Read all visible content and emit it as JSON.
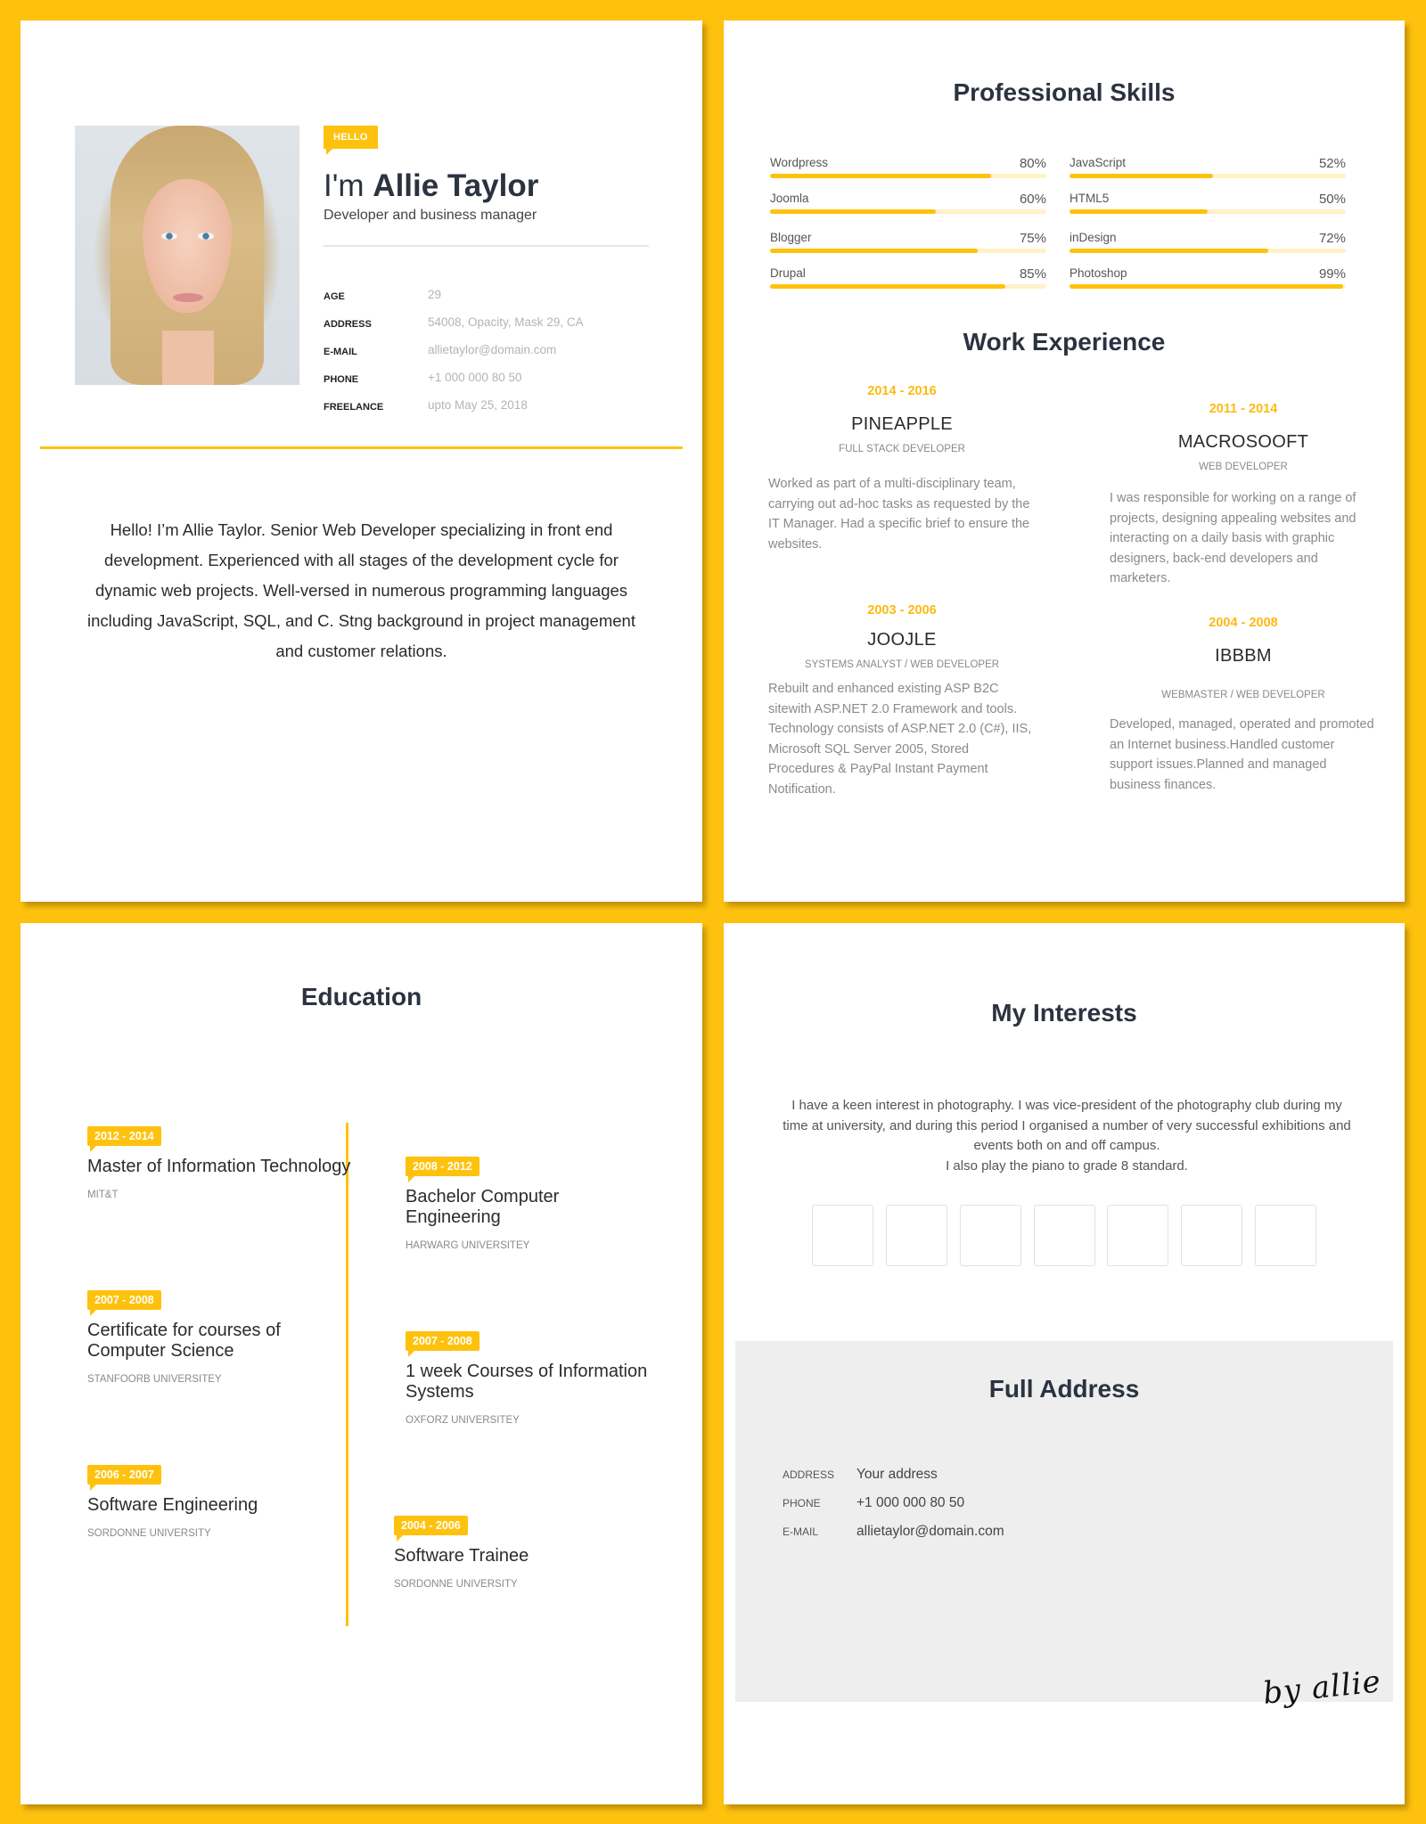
{
  "colors": {
    "background": "#fec20e",
    "accent": "#fec20e",
    "accent_text": "#fdb913",
    "track": "#fff1c8",
    "heading": "#2b3240",
    "address_bg": "#eeeeee"
  },
  "profile": {
    "photo_alt": "portrait-photo",
    "hello_tag": "HELLO",
    "greeting": "I'm",
    "name": "Allie Taylor",
    "subtitle": "Developer and business manager",
    "info": [
      {
        "label": "AGE",
        "value": "29"
      },
      {
        "label": "ADDRESS",
        "value": "54008, Opacity, Mask 29, CA"
      },
      {
        "label": "E-MAIL",
        "value": "allietaylor@domain.com"
      },
      {
        "label": "PHONE",
        "value": "+1 000 000 80 50"
      },
      {
        "label": "FREELANCE",
        "value": "upto May 25, 2018"
      }
    ],
    "bio": "Hello! I’m Allie Taylor. Senior Web Developer specializing in front end development. Experienced with all stages of the development cycle for dynamic web projects. Well-versed in numerous programming languages including JavaScript, SQL, and C. Stng background in project management and customer relations."
  },
  "skills": {
    "title": "Professional Skills",
    "items": [
      {
        "name": "Wordpress",
        "percent": 80,
        "label": "80%"
      },
      {
        "name": "Joomla",
        "percent": 60,
        "label": "60%"
      },
      {
        "name": "Blogger",
        "percent": 75,
        "label": "75%"
      },
      {
        "name": "Drupal",
        "percent": 85,
        "label": "85%"
      },
      {
        "name": "JavaScript",
        "percent": 52,
        "label": "52%"
      },
      {
        "name": "HTML5",
        "percent": 50,
        "label": "50%"
      },
      {
        "name": "inDesign",
        "percent": 72,
        "label": "72%"
      },
      {
        "name": "Photoshop",
        "percent": 99,
        "label": "99%"
      }
    ]
  },
  "experience": {
    "title": "Work Experience",
    "jobs": [
      {
        "dates": "2014 - 2016",
        "company": "PINEAPPLE",
        "role": "FULL STACK DEVELOPER",
        "desc": "Worked as part of a multi-disciplinary team, carrying out ad-hoc tasks as requested by the IT Manager. Had a specific brief to ensure the websites."
      },
      {
        "dates": "2011 - 2014",
        "company": "MACROSOOFT",
        "role": "WEB DEVELOPER",
        "desc": "I was responsible for working on a range of projects, designing appealing websites and interacting on a daily basis with graphic designers, back-end developers and marketers."
      },
      {
        "dates": "2003 - 2006",
        "company": "JOOJLE",
        "role": "SYSTEMS ANALYST / WEB DEVELOPER",
        "desc": "Rebuilt and enhanced existing ASP B2C sitewith ASP.NET 2.0 Framework and tools. Technology consists of ASP.NET 2.0 (C#), IIS, Microsoft SQL Server 2005, Stored Procedures & PayPal Instant Payment Notification."
      },
      {
        "dates": "2004 - 2008",
        "company": "IBBBM",
        "role": "WEBMASTER / WEB DEVELOPER",
        "desc": "Developed, managed, operated and promoted an Internet business.Handled customer support issues.Planned and managed business finances."
      }
    ]
  },
  "education": {
    "title": "Education",
    "items": [
      {
        "dates": "2012 - 2014",
        "title": "Master of Information Technology",
        "school": "MIT&T"
      },
      {
        "dates": "2007 - 2008",
        "title": "Certificate for courses of Computer Science",
        "school": "STANFOORB UNIVERSITEY"
      },
      {
        "dates": "2006 - 2007",
        "title": "Software Engineering",
        "school": "SORDONNE UNIVERSITY"
      },
      {
        "dates": "2008 - 2012",
        "title": "Bachelor Computer Engineering",
        "school": "HARWARG UNIVERSITEY"
      },
      {
        "dates": "2007 - 2008",
        "title": "1 week Courses of Information Systems",
        "school": "OXFORZ UNIVERSITEY"
      },
      {
        "dates": "2004 - 2006",
        "title": "Software Trainee",
        "school": "SORDONNE UNIVERSITY"
      }
    ]
  },
  "interests": {
    "title": "My Interests",
    "text_line1": "I have a keen interest in photography. I was vice-president of the photography club during my time at university, and during this period I organised a number of very successful exhibitions and events both on and off campus.",
    "text_line2": "I also play the piano to grade 8 standard.",
    "icon_boxes": 7
  },
  "address": {
    "title": "Full Address",
    "rows": [
      {
        "label": "ADDRESS",
        "value": "Your address"
      },
      {
        "label": "PHONE",
        "value": "+1 000 000 80 50"
      },
      {
        "label": "E-MAIL",
        "value": "allietaylor@domain.com"
      }
    ],
    "signature": "by allie"
  }
}
